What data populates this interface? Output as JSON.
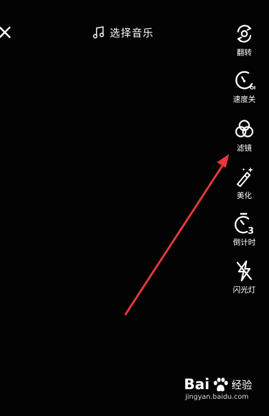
{
  "top_bar": {
    "music_label": "选择音乐",
    "close_icon": "close-icon",
    "music_icon": "music-note-icon"
  },
  "sidebar": {
    "items": [
      {
        "label": "翻转",
        "icon": "flip-camera-icon"
      },
      {
        "label": "速度关",
        "icon": "speedometer-off-icon",
        "badge": "OFF"
      },
      {
        "label": "滤镜",
        "icon": "filter-circles-icon"
      },
      {
        "label": "美化",
        "icon": "magic-wand-icon"
      },
      {
        "label": "倒计时",
        "icon": "countdown-timer-icon",
        "badge": "3"
      },
      {
        "label": "闪光灯",
        "icon": "flash-off-icon"
      }
    ]
  },
  "annotation": {
    "type": "arrow",
    "color": "#e8383a",
    "points_to": "滤镜"
  },
  "watermark": {
    "brand": "Bai",
    "brand_suffix": "经验",
    "url": "jingyan.baidu.com"
  }
}
